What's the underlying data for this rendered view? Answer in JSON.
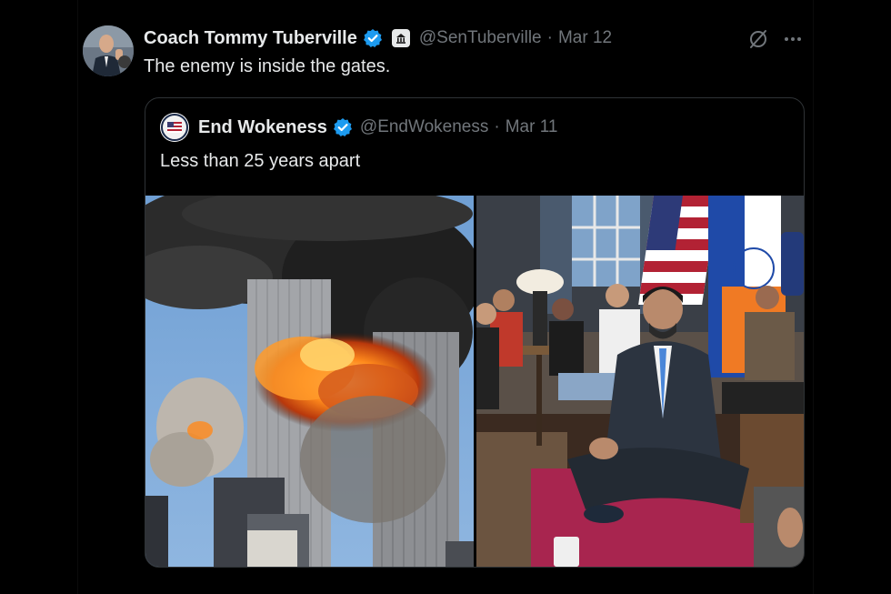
{
  "tweet": {
    "author_name": "Coach Tommy Tuberville",
    "handle": "@SenTuberville",
    "separator": "·",
    "date": "Mar 12",
    "text": "The enemy is inside the gates."
  },
  "quoted_tweet": {
    "author_name": "End Wokeness",
    "handle": "@EndWokeness",
    "separator": "·",
    "date": "Mar 11",
    "text": "Less than 25 years apart"
  },
  "icons": {
    "verified": "verified-badge-icon",
    "affiliation": "senate-affiliation-icon",
    "grok": "grok-icon",
    "more": "more-options-icon"
  },
  "colors": {
    "background": "#000000",
    "text_primary": "#e7e9ea",
    "text_secondary": "#71767b",
    "verified_blue": "#1d9bf0",
    "border": "#2f3336"
  }
}
